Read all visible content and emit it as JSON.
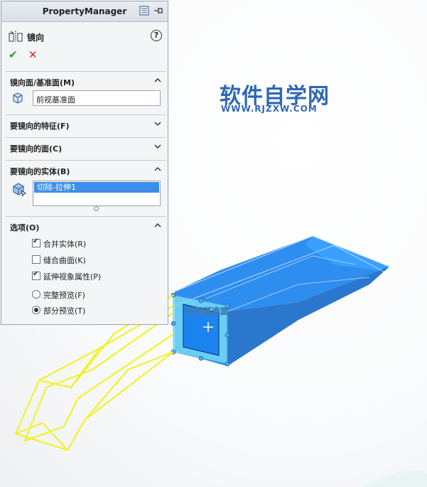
{
  "panel": {
    "title": "PropertyManager",
    "feature_name": "镜向",
    "help_icon": "question-icon",
    "ok_icon": "checkmark-icon",
    "cancel_icon": "x-icon"
  },
  "groups": {
    "mirror_face": {
      "label": "镜向面/基准面(M)",
      "value": "前视基准面"
    },
    "features": {
      "label": "要镜向的特征(F)"
    },
    "faces": {
      "label": "要镜向的面(C)"
    },
    "bodies": {
      "label": "要镜向的实体(B)",
      "items": [
        "切除-拉伸1"
      ]
    },
    "options": {
      "label": "选项(O)",
      "merge_solids": {
        "label": "合并实体(R)",
        "checked": true
      },
      "knit_surfaces": {
        "label": "缝合曲面(K)",
        "checked": false
      },
      "propagate_visual": {
        "label": "延伸视象属性(P)",
        "checked": true
      },
      "full_preview": {
        "label": "完整预览(F)",
        "selected": false
      },
      "partial_preview": {
        "label": "部分预览(T)",
        "selected": true
      }
    }
  },
  "viewport": {
    "plane_label": "前视基准面",
    "watermark_cn": "软件自学网",
    "watermark_url": "WWW.RJZXW.COM"
  },
  "colors": {
    "model_blue": "#1c84ee",
    "preview_yellow": "#f2f21a",
    "plane_cyan": "#5fd0f0",
    "annotation_red": "#e0101a"
  }
}
